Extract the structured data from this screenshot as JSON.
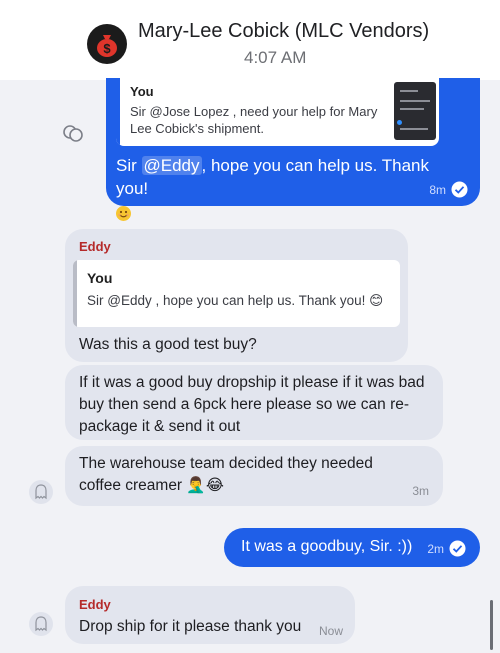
{
  "header": {
    "contact_name": "Mary-Lee Cobick (MLC Vendors)",
    "time": "4:07 AM",
    "avatar_icon": "money-bag-icon"
  },
  "messages": [
    {
      "direction": "outgoing",
      "quote": {
        "author": "You",
        "text": "Sir @Jose Lopez , need your help for Mary Lee Cobick's shipment."
      },
      "text_prefix": "Sir ",
      "mention": "@Eddy",
      "text_suffix": ", hope you can help us. Thank you!",
      "emoji": "smiling-face",
      "time": "8m",
      "status": "read"
    },
    {
      "direction": "incoming",
      "sender": "Eddy",
      "quote": {
        "author": "You",
        "text": "Sir @Eddy , hope you can help us. Thank you! 😊"
      },
      "text": "Was this a good test buy?"
    },
    {
      "direction": "incoming",
      "text": "If it was a good buy dropship it please if it was bad buy then send a 6pck here please so we can re-package it & send it out"
    },
    {
      "direction": "incoming",
      "text": "The warehouse team decided they needed coffee creamer 🤦‍♂️😂",
      "time": "3m"
    },
    {
      "direction": "outgoing",
      "text": "It was a goodbuy, Sir. :))",
      "time": "2m",
      "status": "read"
    },
    {
      "direction": "incoming",
      "sender": "Eddy",
      "text": "Drop ship for it please thank you",
      "time": "Now"
    }
  ],
  "colors": {
    "outgoing_bubble": "#1f5fe8",
    "incoming_bubble": "#e2e5ee",
    "sender_name": "#b52a2a",
    "background": "#f1f2f6"
  }
}
